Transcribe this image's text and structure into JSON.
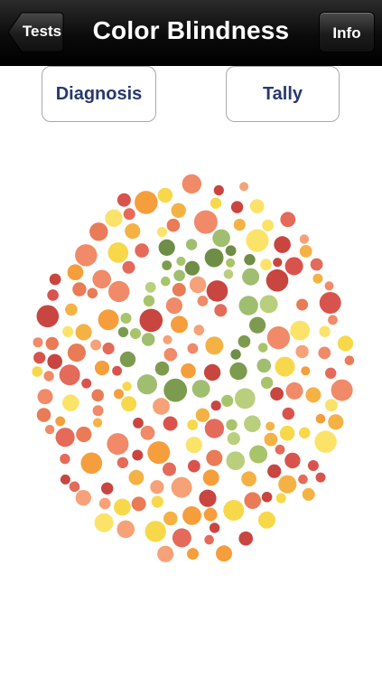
{
  "navbar": {
    "title": "Color Blindness",
    "back_label": "Tests",
    "info_label": "Info"
  },
  "buttons": {
    "diagnosis": "Diagnosis",
    "tally": "Tally"
  },
  "plate": {
    "dot_colors": {
      "background": [
        "#e46a5a",
        "#f08a68",
        "#f6a178",
        "#d9534d",
        "#f4b244",
        "#f7d84a",
        "#fbe36a",
        "#e97b57",
        "#c9453f",
        "#f59e3b"
      ],
      "figure": [
        "#a8c46a",
        "#7d9b4f",
        "#9fbe6f",
        "#6e8d46",
        "#b9cf7d"
      ]
    }
  }
}
